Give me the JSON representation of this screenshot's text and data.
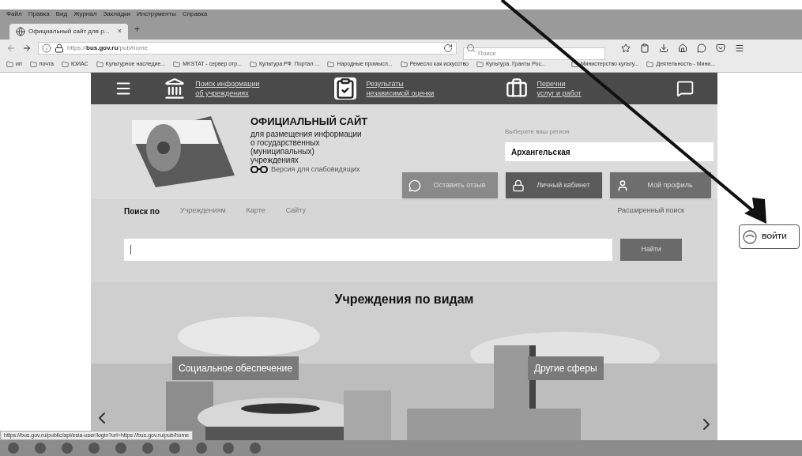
{
  "menu_bar": [
    "Файл",
    "Правка",
    "Вид",
    "Журнал",
    "Закладки",
    "Инструменты",
    "Справка"
  ],
  "tabs": [
    {
      "label": "Официальный сайт для р...",
      "close": "×",
      "selected": true
    }
  ],
  "new_tab": "+",
  "address_bar": {
    "url_host": "https://",
    "url_domain": "bus.gov.ru",
    "url_path": "/pub/home"
  },
  "search_field": {
    "placeholder": "Поиск"
  },
  "bookmarks": [
    "ип",
    "почта",
    "ЮИАС",
    "Культурное наследие...",
    "MKSTAT - сервер отр...",
    "Культура.РФ. Портал ...",
    "Народные промысл...",
    "Ремесло как искусство",
    "Культура. Гранты Рос...",
    "Министерство культу...",
    "Деятельность - Мини..."
  ],
  "site_nav": [
    {
      "kind": "institutions",
      "line1": "Поиск информации",
      "line2": "об учреждениях"
    },
    {
      "kind": "ratings",
      "line1": "Результаты",
      "line2": "независимой оценки"
    },
    {
      "kind": "services",
      "line1": "Перечни",
      "line2": "услуг и работ"
    }
  ],
  "site_title": "ОФИЦИАЛЬНЫЙ САЙТ",
  "site_subtitle": [
    "для размещения информации",
    "о государственных",
    "(муниципальных)",
    "учреждениях"
  ],
  "low_vision_link": "Версия для слабовидящих",
  "region": {
    "label": "Выберите ваш регион",
    "value": "Архангельская"
  },
  "actions": [
    {
      "kind": "feedback",
      "label": "Оставить отзыв"
    },
    {
      "kind": "cabinet",
      "label": "Личный кабинет"
    },
    {
      "kind": "profile",
      "label": "Мой профиль"
    }
  ],
  "search_tabs": {
    "label": "Поиск по",
    "items": [
      {
        "label": "Учреждениям",
        "selected": false
      },
      {
        "label": "Карте",
        "selected": false
      },
      {
        "label": "Сайту",
        "selected": false
      }
    ],
    "advanced": "Расширенный поиск"
  },
  "search_button": "Найти",
  "categories": {
    "title": "Учреждения по видам",
    "items": [
      "Социальное обеспечение",
      "Другие сферы"
    ]
  },
  "login_button": "ВОЙТИ",
  "status_url": "https://bus.gov.ru/public/api/esia-user/login?url=https://bus.gov.ru/pub/home"
}
